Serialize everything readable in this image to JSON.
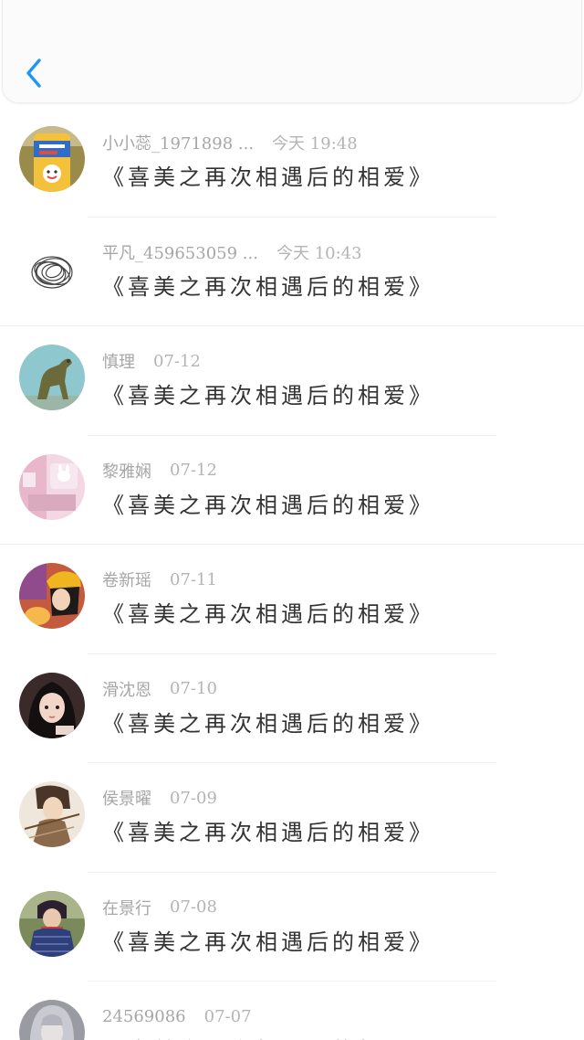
{
  "colors": {
    "accent": "#2196F3",
    "meta_text": "#a6a6a6",
    "message_text": "#333333",
    "divider": "#f0f0f0"
  },
  "header": {
    "back_icon": "chevron-left-icon"
  },
  "comments": [
    {
      "name": "小小蕊_1971898 ...",
      "time": "今天 19:48",
      "message": "《喜美之再次相遇后的相爱》"
    },
    {
      "name": "平凡_459653059 ...",
      "time": "今天 10:43",
      "message": "《喜美之再次相遇后的相爱》"
    },
    {
      "name": "慎理",
      "time": "07-12",
      "message": "《喜美之再次相遇后的相爱》"
    },
    {
      "name": "黎雅娴",
      "time": "07-12",
      "message": "《喜美之再次相遇后的相爱》"
    },
    {
      "name": "卷新瑶",
      "time": "07-11",
      "message": "《喜美之再次相遇后的相爱》"
    },
    {
      "name": "滑沈恩",
      "time": "07-10",
      "message": "《喜美之再次相遇后的相爱》"
    },
    {
      "name": "侯景曜",
      "time": "07-09",
      "message": "《喜美之再次相遇后的相爱》"
    },
    {
      "name": "在景行",
      "time": "07-08",
      "message": "《喜美之再次相遇后的相爱》"
    },
    {
      "name": "24569086",
      "time": "07-07",
      "message": "《喜美之再次相遇后的相爱》"
    }
  ]
}
